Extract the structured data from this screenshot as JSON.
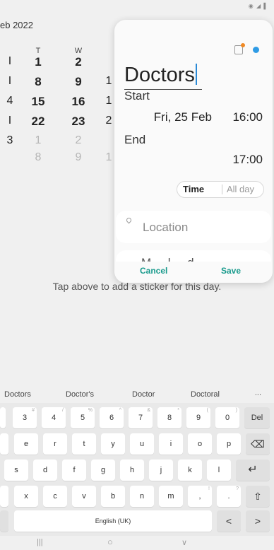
{
  "status_bar": {
    "icons": "◉ ◢ ▌"
  },
  "calendar": {
    "month_label": "eb 2022",
    "headers": [
      "T",
      "W"
    ],
    "rows": [
      [
        "1",
        "2"
      ],
      [
        "8",
        "9"
      ],
      [
        "15",
        "16"
      ],
      [
        "22",
        "23"
      ],
      [
        "1",
        "2"
      ],
      [
        "8",
        "9"
      ]
    ],
    "left_partial": [
      "I",
      "I",
      "4",
      "I",
      "3",
      ""
    ],
    "right_partial": [
      "",
      "1",
      "1",
      "2",
      "",
      "1"
    ]
  },
  "sticker_hint": "Tap above to add a sticker for this day.",
  "event": {
    "title": "Doctors",
    "start_label": "Start",
    "start_date": "Fri, 25 Feb",
    "start_time": "16:00",
    "end_label": "End",
    "end_time": "17:00",
    "toggle_time": "Time",
    "toggle_all_day": "All day",
    "location_placeholder": "Location",
    "more_partial": "M  ...  l  ...  d",
    "cancel_label": "Cancel",
    "save_label": "Save",
    "accent_color": "#189a8c",
    "color_dot": "#2e9be5",
    "sticker_badge_color": "#f08a24"
  },
  "keyboard": {
    "suggestions": [
      "Doctors",
      "Doctor's",
      "Doctor",
      "Doctoral"
    ],
    "more_suggestions": "...",
    "number_row": [
      {
        "key": "3",
        "hint": "#"
      },
      {
        "key": "4",
        "hint": "/"
      },
      {
        "key": "5",
        "hint": "%"
      },
      {
        "key": "6",
        "hint": "^"
      },
      {
        "key": "7",
        "hint": "&"
      },
      {
        "key": "8",
        "hint": "*"
      },
      {
        "key": "9",
        "hint": "("
      },
      {
        "key": "0",
        "hint": ")"
      }
    ],
    "del_label": "Del",
    "row2": [
      "e",
      "r",
      "t",
      "y",
      "u",
      "i",
      "o",
      "p"
    ],
    "row3": [
      "s",
      "d",
      "f",
      "g",
      "h",
      "j",
      "k",
      "l"
    ],
    "row4": [
      {
        "key": "x",
        "hint": ""
      },
      {
        "key": "c",
        "hint": ""
      },
      {
        "key": "v",
        "hint": ""
      },
      {
        "key": "b",
        "hint": ""
      },
      {
        "key": "n",
        "hint": ""
      },
      {
        "key": "m",
        "hint": ""
      },
      {
        "key": ",",
        "hint": "!"
      },
      {
        "key": ".",
        "hint": "?"
      }
    ],
    "space_label": "English (UK)",
    "backspace_icon": "⌫",
    "enter_icon": "↵",
    "shift_icon": "⇧",
    "left_arrow": "<",
    "right_arrow": ">"
  },
  "nav": {
    "recents": "|||",
    "home": "○",
    "back": "∨"
  }
}
